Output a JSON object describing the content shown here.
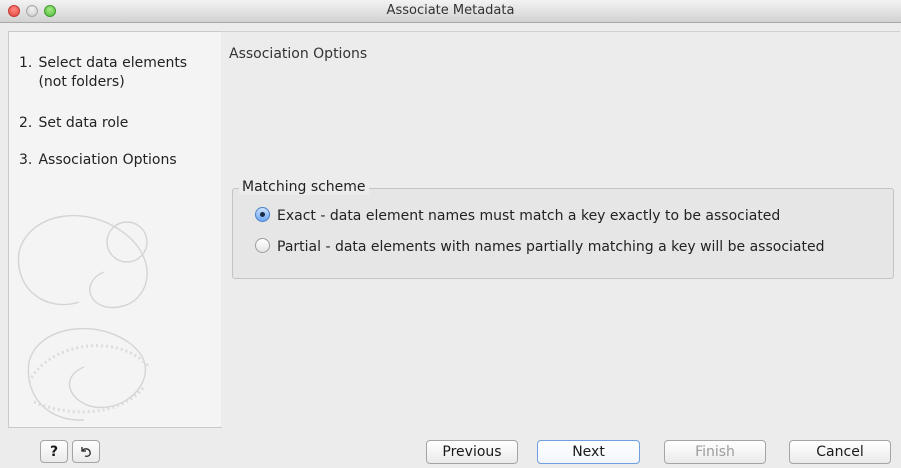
{
  "window": {
    "title": "Associate Metadata"
  },
  "steps": [
    {
      "num": "1.",
      "label": "Select data elements",
      "label2": "(not folders)"
    },
    {
      "num": "2.",
      "label": "Set data role"
    },
    {
      "num": "3.",
      "label": "Association Options"
    }
  ],
  "main": {
    "section_title": "Association Options",
    "matching": {
      "label": "Matching scheme",
      "options": [
        {
          "label": "Exact - data element names must match a key exactly to be associated",
          "checked": true
        },
        {
          "label": "Partial - data elements with names partially matching a key will be associated",
          "checked": false
        }
      ]
    }
  },
  "footer": {
    "help_icon": "?",
    "reset_icon": "reset-arrow-icon",
    "previous_label": "Previous",
    "next_label": "Next",
    "finish_label": "Finish",
    "cancel_label": "Cancel"
  },
  "colors": {
    "accent": "#4a7fc5",
    "close": "#e0443e",
    "zoom": "#4fb83a"
  }
}
